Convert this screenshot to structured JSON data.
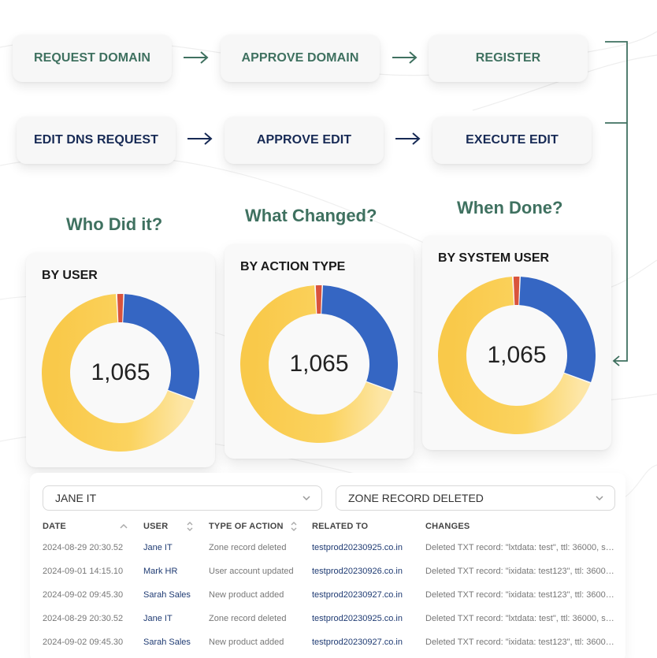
{
  "workflow": {
    "row1": [
      {
        "label": "REQUEST DOMAIN"
      },
      {
        "label": "APPROVE DOMAIN"
      },
      {
        "label": "REGISTER"
      }
    ],
    "row2": [
      {
        "label": "EDIT DNS REQUEST"
      },
      {
        "label": "APPROVE EDIT"
      },
      {
        "label": "EXECUTE EDIT"
      }
    ]
  },
  "headings": {
    "who": "Who Did it?",
    "what": "What Changed?",
    "when": "When Done?"
  },
  "cards": [
    {
      "title": "BY USER",
      "total": "1,065"
    },
    {
      "title": "BY ACTION TYPE",
      "total": "1,065"
    },
    {
      "title": "BY SYSTEM USER",
      "total": "1,065"
    }
  ],
  "donut": {
    "segments": [
      {
        "share": 0.3,
        "color": "#3566c3"
      },
      {
        "share": 0.685,
        "color": "#f9c94a"
      },
      {
        "share": 0.015,
        "color": "#d9533c"
      }
    ]
  },
  "filters": {
    "user": "JANE IT",
    "action": "ZONE RECORD DELETED"
  },
  "table": {
    "columns": [
      "DATE",
      "USER",
      "TYPE OF ACTION",
      "RELATED TO",
      "CHANGES"
    ],
    "rows": [
      {
        "date": "2024-08-29 20:30.52",
        "user": "Jane IT",
        "action": "Zone record deleted",
        "related": "testprod20230925.co.in",
        "changes": "Deleted TXT record: \"lxtdata: test\", ttl: 36000, su..."
      },
      {
        "date": "2024-09-01 14:15.10",
        "user": "Mark HR",
        "action": "User account updated",
        "related": "testprod20230926.co.in",
        "changes": "Deleted TXT record: \"ixidata: test123\", ttl: 36000,..."
      },
      {
        "date": "2024-09-02 09:45.30",
        "user": "Sarah Sales",
        "action": "New product added",
        "related": "testprod20230927.co.in",
        "changes": "Deleted TXT record: \"ixidata: test123\", ttl: 36000,..."
      },
      {
        "date": "2024-08-29 20:30.52",
        "user": "Jane IT",
        "action": "Zone record deleted",
        "related": "testprod20230925.co.in",
        "changes": "Deleted TXT record: \"lxtdata: test\", ttl: 36000, su..."
      },
      {
        "date": "2024-09-02 09:45.30",
        "user": "Sarah Sales",
        "action": "New product added",
        "related": "testprod20230927.co.in",
        "changes": "Deleted TXT record: \"ixidata: test123\", ttl: 36000,..."
      }
    ]
  },
  "colors": {
    "green": "#3f7160",
    "navy": "#172a55",
    "blue_segment": "#3566c3",
    "yellow_segment": "#f9c94a",
    "red_segment": "#d9533c"
  }
}
